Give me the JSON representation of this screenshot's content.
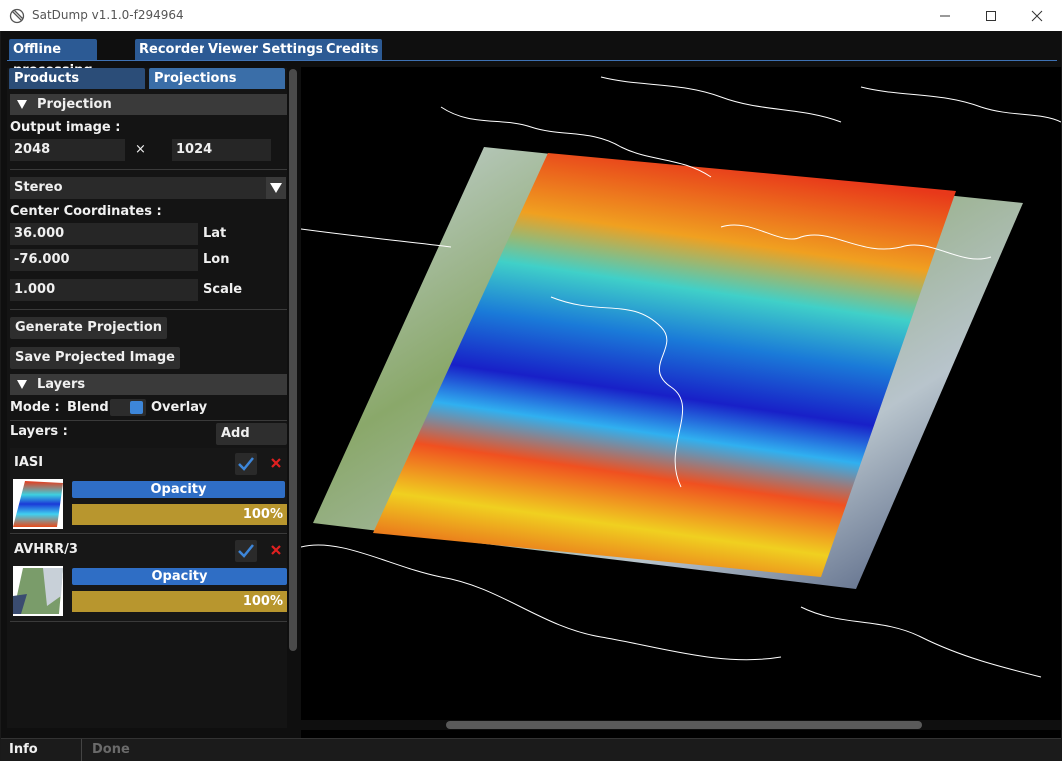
{
  "window": {
    "title": "SatDump v1.1.0-f294964"
  },
  "tabs": [
    "Offline processing",
    "Recorder",
    "Viewer",
    "Settings",
    "Credits"
  ],
  "subtabs": [
    "Products",
    "Projections"
  ],
  "projection": {
    "header": "Projection",
    "output_label": "Output image :",
    "width": "2048",
    "times": "×",
    "height": "1024",
    "type": "Stereo",
    "center_label": "Center Coordinates :",
    "lat": "36.000",
    "lat_label": "Lat",
    "lon": "-76.000",
    "lon_label": "Lon",
    "scale": "1.000",
    "scale_label": "Scale",
    "generate": "Generate Projection",
    "save": "Save Projected Image"
  },
  "layers": {
    "header": "Layers",
    "mode_label": "Mode :",
    "mode_blend": "Blend",
    "mode_overlay": "Overlay",
    "layers_label": "Layers :",
    "add_layer": "Add Layer",
    "items": [
      {
        "name": "IASI",
        "opacity_label": "Opacity",
        "opacity_value": "100%",
        "opacity_fraction": 1.0
      },
      {
        "name": "AVHRR/3",
        "opacity_label": "Opacity",
        "opacity_value": "100%",
        "opacity_fraction": 1.0
      }
    ]
  },
  "status": {
    "label": "Info",
    "text": "Done"
  },
  "colors": {
    "accent": "#2c5a94",
    "slider": "#b8962e",
    "check": "#3d86d9",
    "delete": "#e02020"
  },
  "icons": [
    "satdump-icon",
    "minimize-icon",
    "maximize-icon",
    "close-icon",
    "triangle-down-icon",
    "checkmark-icon",
    "delete-x-icon"
  ]
}
